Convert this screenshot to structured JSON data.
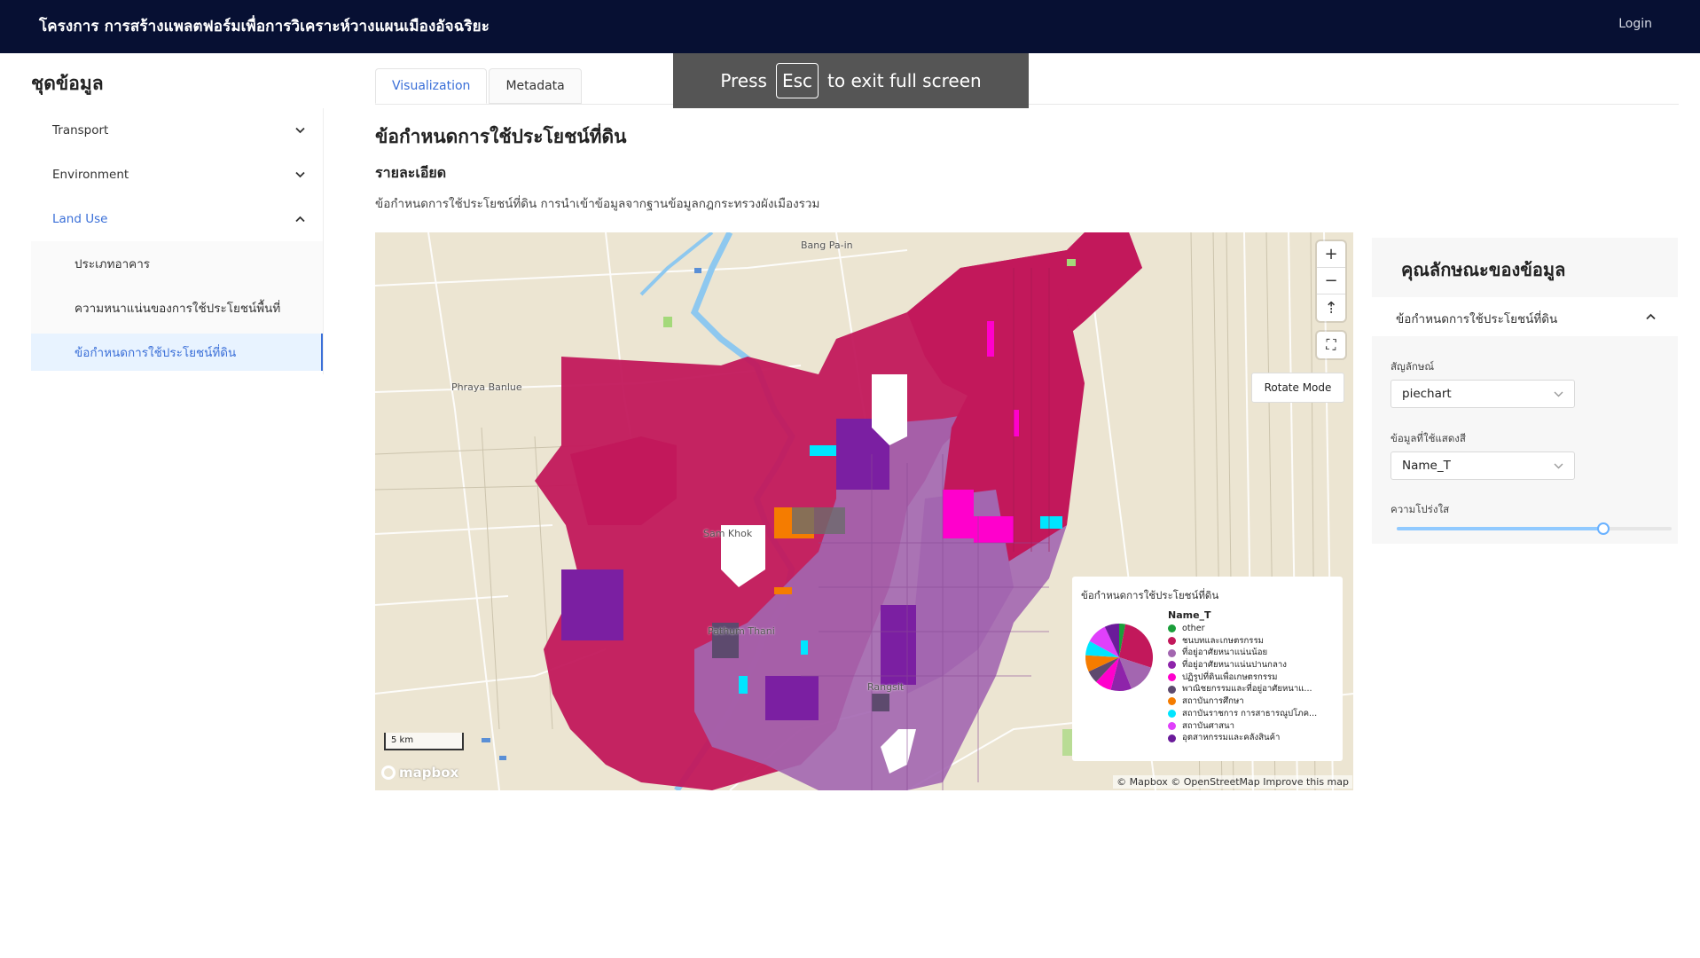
{
  "header": {
    "title": "โครงการ การสร้างแพลตฟอร์มเพื่อการวิเคราะห์วางแผนเมืองอัจฉริยะ",
    "login": "Login"
  },
  "fullscreen_banner": {
    "before": "Press",
    "key": "Esc",
    "after": "to exit full screen"
  },
  "sidebar": {
    "title": "ชุดข้อมูล",
    "items": [
      {
        "label": "Transport"
      },
      {
        "label": "Environment"
      },
      {
        "label": "Land Use"
      }
    ],
    "sub_items": [
      {
        "label": "ประเภทอาคาร"
      },
      {
        "label": "ความหนาแน่นของการใช้ประโยชน์พื้นที่"
      },
      {
        "label": "ข้อกำหนดการใช้ประโยชน์ที่ดิน"
      }
    ]
  },
  "tabs": [
    {
      "label": "Visualization"
    },
    {
      "label": "Metadata"
    }
  ],
  "content": {
    "title": "ข้อกำหนดการใช้ประโยชน์ที่ดิน",
    "subtitle": "รายละเอียด",
    "description": "ข้อกำหนดการใช้ประโยชน์ที่ดิน การนำเข้าข้อมูลจากฐานข้อมูลกฎกระทรวงผังเมืองรวม"
  },
  "map": {
    "labels": {
      "bang_pa_in": "Bang Pa-in",
      "phraya_banlue": "Phraya Banlue",
      "sam_khok": "Sam Khok",
      "pathum_thani": "Pathum Thani",
      "rangsit": "Rangsit"
    },
    "rotate_mode": "Rotate Mode",
    "zoom_in": "+",
    "zoom_out": "−",
    "compass": "⇡",
    "fullscreen": "⛶",
    "scale": "5 km",
    "logo": "mapbox",
    "attribution": "© Mapbox © OpenStreetMap Improve this map",
    "colors": {
      "pink": "#c2185b",
      "purple_light": "#a366b0",
      "purple_dark": "#7b1fa2",
      "magenta": "#ff00cc",
      "cyan": "#00e5ff",
      "orange": "#f57c00",
      "water": "#8ec8ef"
    }
  },
  "legend": {
    "title": "ข้อกำหนดการใช้ประโยชน์ที่ดิน",
    "field": "Name_T",
    "items": [
      {
        "label": "other",
        "color": "#1a9e3a"
      },
      {
        "label": "ชนบทและเกษตรกรรม",
        "color": "#c2185b"
      },
      {
        "label": "ที่อยู่อาศัยหนาแน่นน้อย",
        "color": "#a366b0"
      },
      {
        "label": "ที่อยู่อาศัยหนาแน่นปานกลาง",
        "color": "#8e24aa"
      },
      {
        "label": "ปฏิรูปที่ดินเพื่อเกษตรกรรม",
        "color": "#ff00cc"
      },
      {
        "label": "พาณิชยกรรมและที่อยู่อาศัยหนาแ...",
        "color": "#5d4a6e"
      },
      {
        "label": "สถาบันการศึกษา",
        "color": "#f57c00"
      },
      {
        "label": "สถาบันราชการ การสาธารณูปโภค...",
        "color": "#00e5ff"
      },
      {
        "label": "สถาบันศาสนา",
        "color": "#e040fb"
      },
      {
        "label": "อุตสาหกรรมและคลังสินค้า",
        "color": "#6a1b9a"
      }
    ]
  },
  "chart_data": {
    "type": "pie",
    "categories": [
      "other",
      "ชนบทและเกษตรกรรม",
      "ที่อยู่อาศัยหนาแน่นน้อย",
      "ที่อยู่อาศัยหนาแน่นปานกลาง",
      "ปฏิรูปที่ดินเพื่อเกษตรกรรม",
      "พาณิชยกรรมและที่อยู่อาศัยหนาแ...",
      "สถาบันการศึกษา",
      "สถาบันราชการ การสาธารณูปโภค...",
      "สถาบันศาสนา",
      "อุตสาหกรรมและคลังสินค้า"
    ],
    "values": [
      3,
      27,
      14,
      10,
      8,
      6,
      8,
      7,
      10,
      7
    ],
    "colors": [
      "#1a9e3a",
      "#c2185b",
      "#a366b0",
      "#8e24aa",
      "#ff00cc",
      "#5d4a6e",
      "#f57c00",
      "#00e5ff",
      "#e040fb",
      "#6a1b9a"
    ]
  },
  "properties": {
    "title": "คุณลักษณะของข้อมูล",
    "section": "ข้อกำหนดการใช้ประโยชน์ที่ดิน",
    "symbol_label": "สัญลักษณ์",
    "symbol_value": "piechart",
    "color_field_label": "ข้อมูลที่ใช้แสดงสี",
    "color_field_value": "Name_T",
    "opacity_label": "ความโปร่งใส",
    "opacity_value": 0.75
  }
}
